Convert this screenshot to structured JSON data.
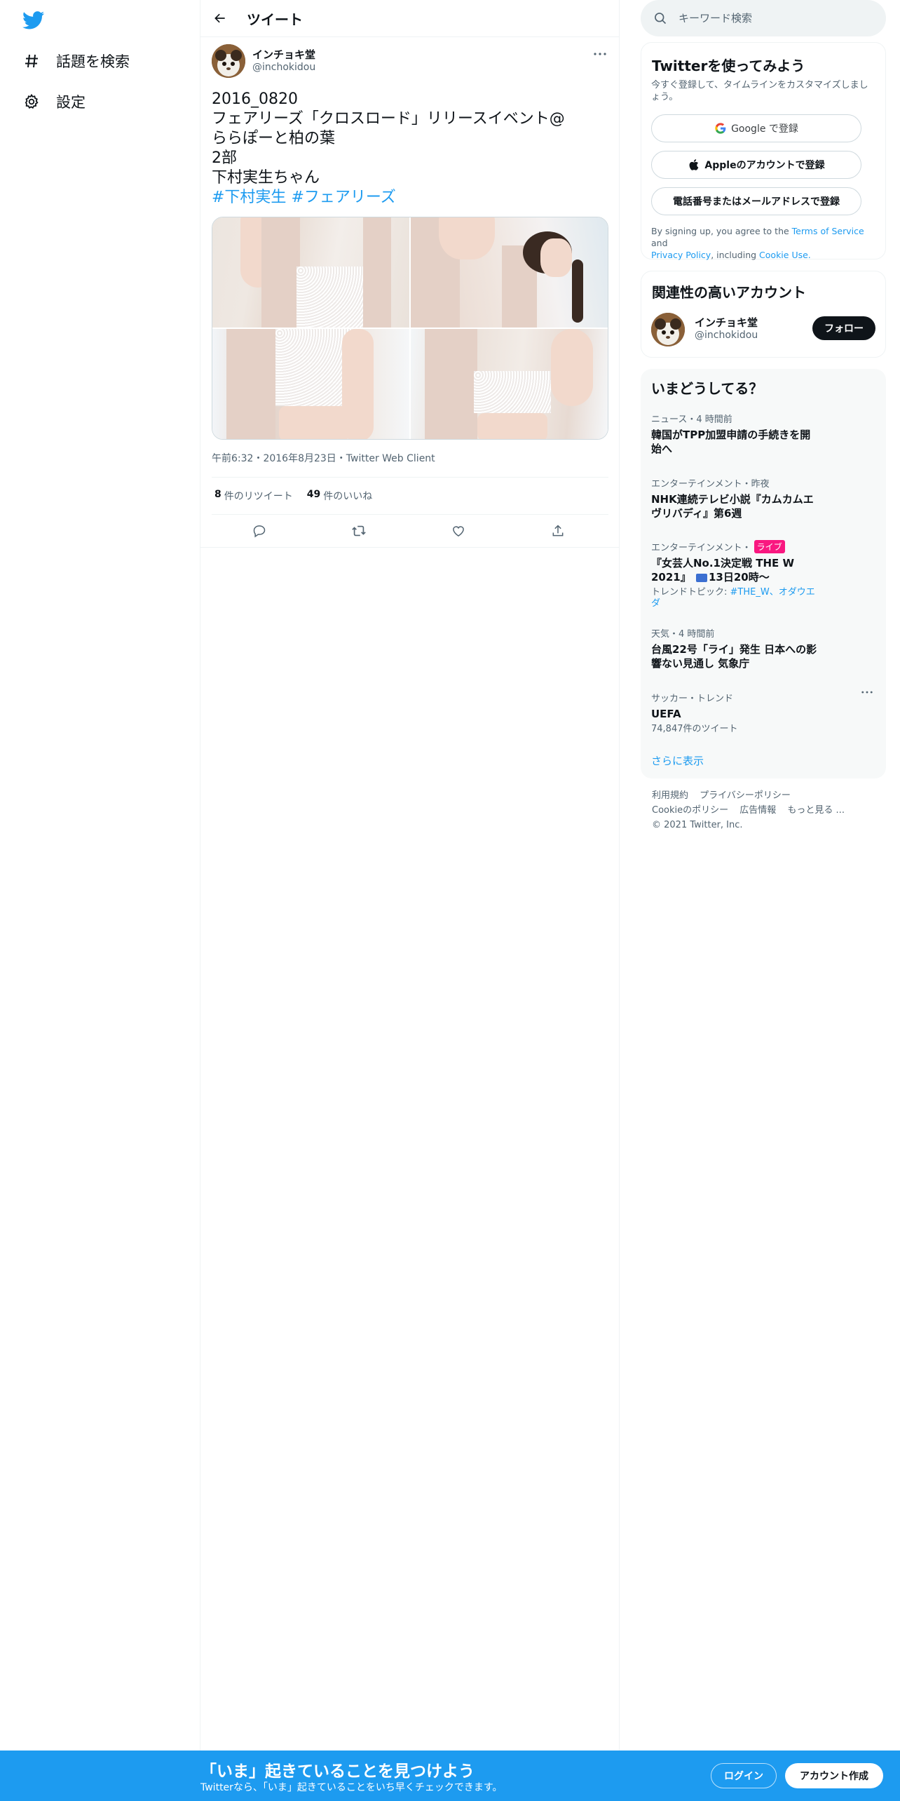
{
  "nav": {
    "explore_label": "話題を検索",
    "settings_label": "設定"
  },
  "header": {
    "title": "ツイート"
  },
  "tweet": {
    "author_name": "インチョキ堂",
    "author_handle": "@inchokidou",
    "lines": [
      "2016_0820",
      "フェアリーズ「クロスロード」リリースイベント@",
      "ららぽーと柏の葉",
      "2部",
      "下村実生ちゃん"
    ],
    "hashtags": [
      "#下村実生",
      "#フェアリーズ"
    ],
    "meta": "午前6:32・2016年8月23日・Twitter Web Client",
    "retweets_count": "8",
    "retweets_label": "件のリツイート",
    "likes_count": "49",
    "likes_label": "件のいいね",
    "photo_count": 4
  },
  "search": {
    "placeholder": "キーワード検索"
  },
  "signup_card": {
    "title": "Twitterを使ってみよう",
    "subtitle": "今すぐ登録して、タイムラインをカスタマイズしましょう。",
    "google_label": "Google で登録",
    "apple_label": "Appleのアカウントで登録",
    "phone_label": "電話番号またはメールアドレスで登録",
    "legal_prefix": "By signing up, you agree to the",
    "terms_link": "Terms of Service",
    "legal_and": "and",
    "privacy_link": "Privacy Policy",
    "legal_including": ", including",
    "cookie_link": "Cookie Use."
  },
  "related": {
    "title": "関連性の高いアカウント",
    "name": "インチョキ堂",
    "handle": "@inchokidou",
    "follow_label": "フォロー"
  },
  "trends": {
    "title": "いまどうしてる？",
    "items": [
      {
        "context": "ニュース・4 時間前",
        "title": "韓国がTPP加盟申請の手続きを開始へ"
      },
      {
        "context": "エンターテインメント・昨夜",
        "title": "NHK連続テレビ小説『カムカムエヴリバディ』第6週"
      },
      {
        "context": "エンターテインメント・",
        "badge": "ライブ",
        "title_a": "『女芸人No.1決定戦 THE W 2021』",
        "title_b": "13日20時〜",
        "extra_prefix": "トレンドトピック: ",
        "extra_link": "#THE_W、オダウエダ"
      },
      {
        "context": "天気・4 時間前",
        "title": "台風22号「ライ」発生 日本への影響ない見通し 気象庁"
      },
      {
        "context": "サッカー・トレンド",
        "title": "UEFA",
        "extra": "74,847件のツイート"
      }
    ],
    "show_more": "さらに表示"
  },
  "footer": {
    "terms": "利用規約",
    "privacy": "プライバシーポリシー",
    "cookie": "Cookieのポリシー",
    "ads": "広告情報",
    "more": "もっと見る ...",
    "copyright": "© 2021 Twitter, Inc."
  },
  "banner": {
    "title": "「いま」起きていることを見つけよう",
    "subtitle": "Twitterなら、「いま」起きていることをいち早くチェックできます。",
    "login_label": "ログイン",
    "signup_label": "アカウント作成"
  },
  "colors": {
    "accent": "#1d9bf0",
    "text": "#0f1419",
    "secondary": "#536471",
    "live_badge": "#f91880"
  }
}
